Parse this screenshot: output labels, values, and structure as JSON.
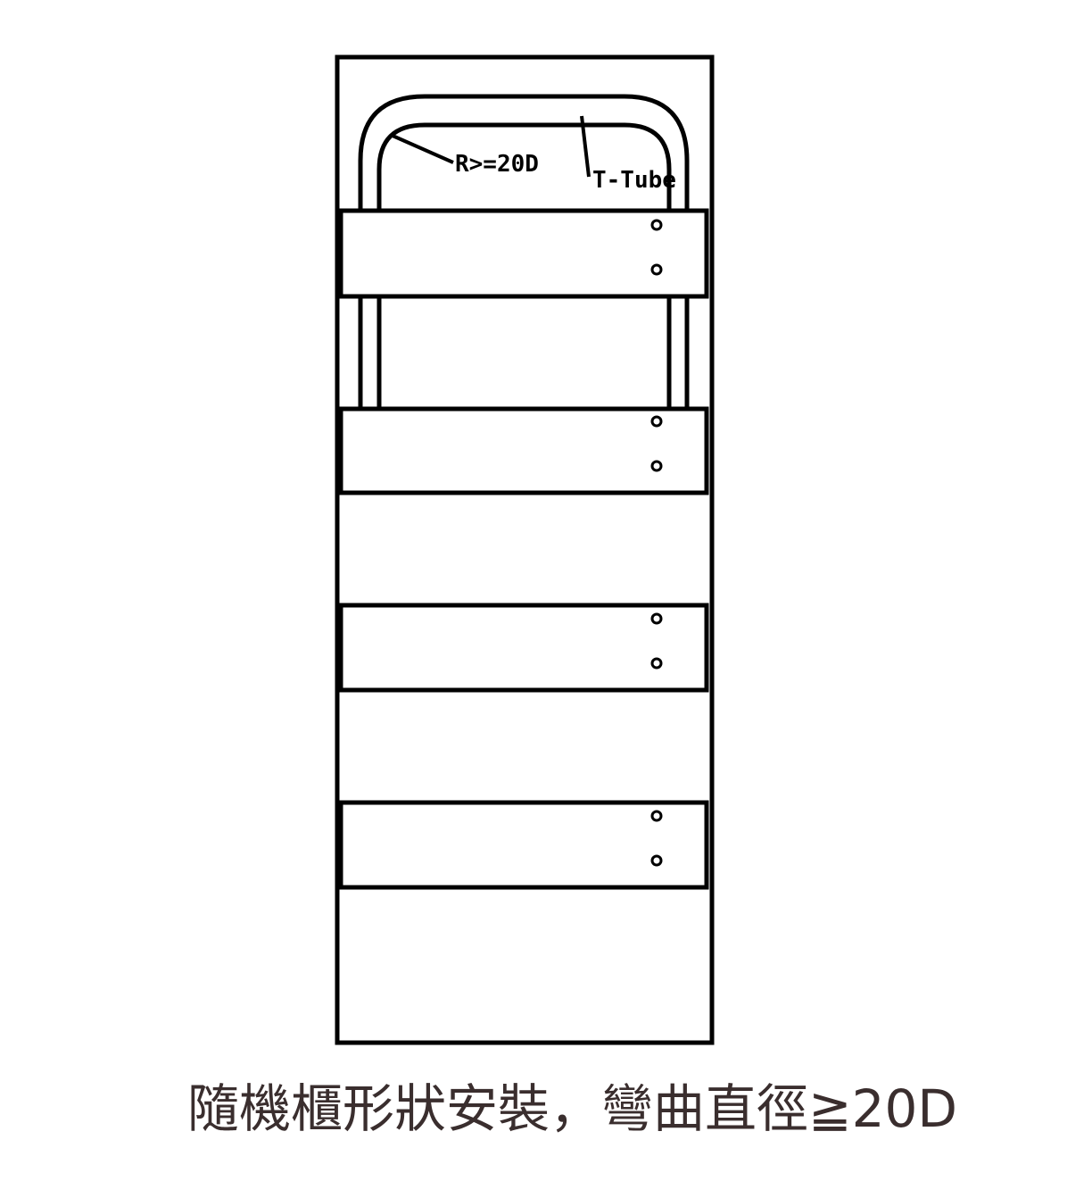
{
  "diagram": {
    "labels": {
      "bend_radius": "R>=20D",
      "tube": "T-Tube"
    },
    "panel_count": 4,
    "colors": {
      "stroke": "#000000",
      "background": "#ffffff",
      "caption": "#3a2e2e"
    }
  },
  "caption": "隨機櫃形狀安裝，彎曲直徑≧20D"
}
